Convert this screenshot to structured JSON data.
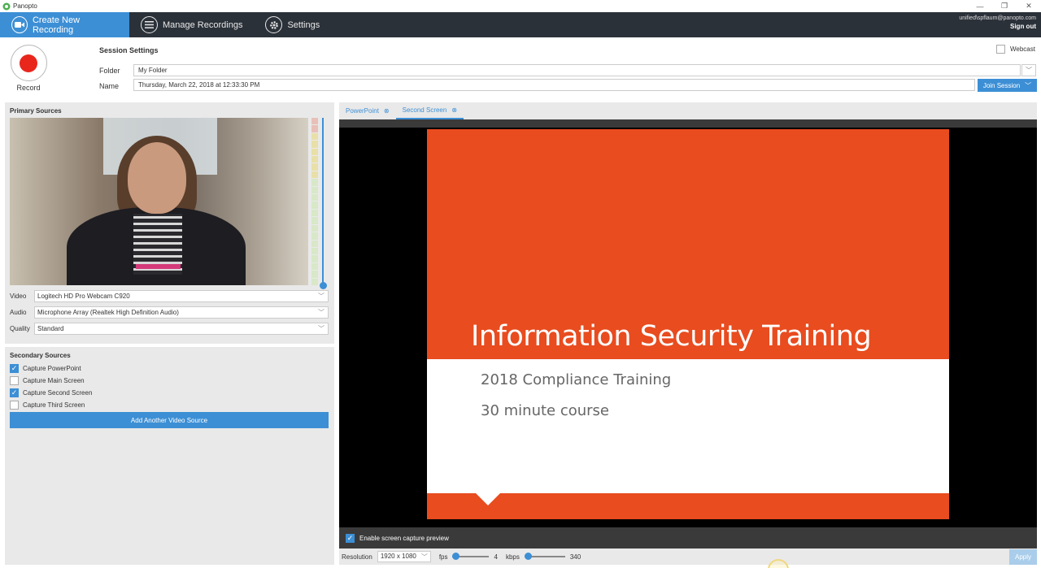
{
  "app": {
    "title": "Panopto"
  },
  "window_controls": {
    "minimize": "—",
    "restore": "❐",
    "close": "✕"
  },
  "nav": {
    "tabs": [
      {
        "label": "Create New Recording",
        "icon": "camera-icon"
      },
      {
        "label": "Manage Recordings",
        "icon": "list-icon"
      },
      {
        "label": "Settings",
        "icon": "gear-icon"
      }
    ],
    "user_email": "unified\\spflaum@panopto.com",
    "sign_out": "Sign out"
  },
  "session": {
    "record_label": "Record",
    "title": "Session Settings",
    "folder_label": "Folder",
    "folder_value": "My Folder",
    "name_label": "Name",
    "name_value": "Thursday, March 22, 2018 at 12:33:30 PM",
    "webcast_label": "Webcast",
    "webcast_checked": false,
    "join_session": "Join Session"
  },
  "primary_sources": {
    "title": "Primary Sources",
    "video_label": "Video",
    "video_value": "Logitech HD Pro Webcam C920",
    "audio_label": "Audio",
    "audio_value": "Microphone Array (Realtek High Definition Audio)",
    "quality_label": "Quality",
    "quality_value": "Standard"
  },
  "secondary_sources": {
    "title": "Secondary Sources",
    "items": [
      {
        "label": "Capture PowerPoint",
        "checked": true
      },
      {
        "label": "Capture Main Screen",
        "checked": false
      },
      {
        "label": "Capture Second Screen",
        "checked": true
      },
      {
        "label": "Capture Third Screen",
        "checked": false
      }
    ],
    "add_button": "Add Another Video Source"
  },
  "preview": {
    "tabs": [
      {
        "label": "PowerPoint",
        "active": false
      },
      {
        "label": "Second Screen",
        "active": true
      }
    ],
    "slide": {
      "title": "Information Security Training",
      "subtitle1": "2018 Compliance Training",
      "subtitle2": "30 minute course"
    },
    "enable_capture_label": "Enable screen capture preview",
    "enable_capture_checked": true
  },
  "capture_settings": {
    "resolution_label": "Resolution",
    "resolution_value": "1920 x 1080",
    "fps_label": "fps",
    "fps_value": "4",
    "kbps_label": "kbps",
    "kbps_value": "340",
    "apply": "Apply"
  },
  "colors": {
    "accent": "#3c8fd5",
    "nav_bg": "#2b3139",
    "record_red": "#e8261c",
    "slide_orange": "#e84c1f"
  }
}
